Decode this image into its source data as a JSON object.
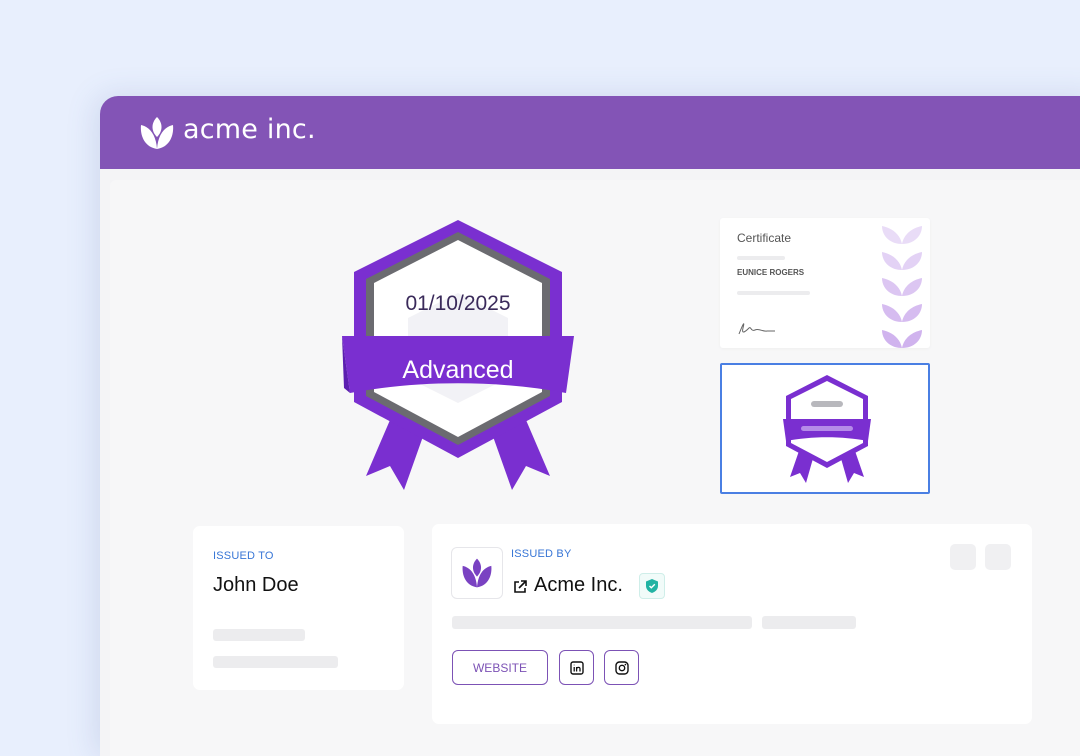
{
  "header": {
    "brand": "acme inc.",
    "logo_icon": "acme-leaf-logo-icon",
    "bg_color": "#8354b6"
  },
  "badge": {
    "date": "01/10/2025",
    "level": "Advanced",
    "accent_color": "#7a2fd0"
  },
  "preview": {
    "certificate_title": "Certificate",
    "certificate_name": "EUNICE ROGERS",
    "selected": "badge-thumbnail"
  },
  "issued_to": {
    "label": "ISSUED TO",
    "name": "John Doe"
  },
  "issued_by": {
    "label": "ISSUED BY",
    "name": "Acme Inc.",
    "link_icon": "external-link-icon",
    "verified_icon": "verified-shield-icon",
    "buttons": {
      "website": "WEBSITE",
      "linkedin_icon": "linkedin-icon",
      "instagram_icon": "instagram-icon"
    }
  }
}
